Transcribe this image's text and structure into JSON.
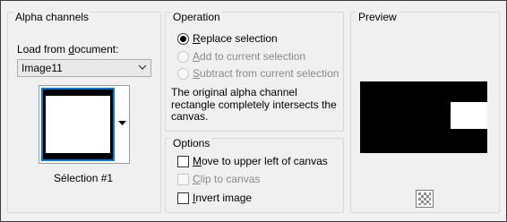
{
  "alpha_channels": {
    "title": "Alpha channels",
    "load_label_pre": "Load from ",
    "load_label_key": "d",
    "load_label_post": "ocument:",
    "document_value": "Image11",
    "selection_name": "Sélection #1"
  },
  "operation": {
    "title": "Operation",
    "options": [
      {
        "key": "R",
        "rest": "eplace selection",
        "selected": true,
        "enabled": true
      },
      {
        "key": "A",
        "rest": "dd to current selection",
        "selected": false,
        "enabled": false
      },
      {
        "key": "S",
        "rest": "ubtract from current selection",
        "selected": false,
        "enabled": false
      }
    ],
    "description_lines": [
      "The original alpha channel",
      "rectangle completely intersects the",
      "canvas."
    ]
  },
  "options": {
    "title": "Options",
    "items": [
      {
        "key": "M",
        "rest": "ove to upper left of canvas",
        "checked": false,
        "enabled": true
      },
      {
        "key": "C",
        "rest": "lip to canvas",
        "checked": false,
        "enabled": false
      },
      {
        "key": "I",
        "rest": "nvert image",
        "checked": false,
        "enabled": true
      }
    ]
  },
  "preview": {
    "title": "Preview",
    "checker_icon": "checkerboard-icon"
  }
}
